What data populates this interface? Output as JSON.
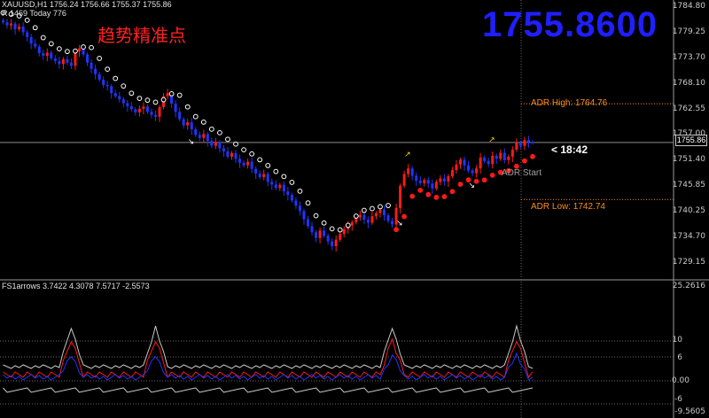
{
  "header": {
    "symbol_line": "XAUUSD,H1  1756.24 1756.66 1755.37 1755.86",
    "info_line": "R 1469  Today 776",
    "annotation_cn": "趋势精准点",
    "big_price": "1755.8600"
  },
  "labels": {
    "adr_high": "ADR High: 1764.76",
    "adr_low": "ADR Low: 1742.74",
    "adr_start": "ADR Start",
    "countdown": "< 18:42",
    "current_price": "1755.86"
  },
  "colors": {
    "bull": "#ff1a1a",
    "bear": "#1f35ff",
    "trail": "#ffffff",
    "adr": "#ff8c1a",
    "big_price": "#1f1fff",
    "arrow_up": "#ffd400"
  },
  "price_axis": {
    "ticks": [
      "1784.80",
      "1779.25",
      "1773.70",
      "1768.10",
      "1762.55",
      "1757.00",
      "1751.40",
      "1745.85",
      "1740.25",
      "1734.70",
      "1729.15"
    ]
  },
  "indicator": {
    "name_line": "FS1arrows 3.7422 4.3078 7.5717 -2.5573",
    "ticks": [
      "25.2616",
      "10",
      "6",
      "0.00",
      "-6",
      "-9.5605"
    ]
  },
  "chart_data": {
    "type": "candlestick",
    "title": "XAUUSD,H1",
    "current_price": 1755.86,
    "adr_high": 1764.76,
    "adr_low": 1742.74,
    "ylim": [
      1726.5,
      1787.0
    ],
    "close_series": [
      1783.5,
      1782.8,
      1783.2,
      1781.9,
      1782.5,
      1781.2,
      1780.1,
      1778.6,
      1777.9,
      1776.4,
      1775.8,
      1776.5,
      1775.2,
      1774.6,
      1773.9,
      1775.0,
      1774.2,
      1773.5,
      1776.8,
      1777.5,
      1776.1,
      1774.2,
      1772.8,
      1771.6,
      1770.3,
      1769.1,
      1768.8,
      1767.2,
      1766.5,
      1765.8,
      1764.9,
      1764.2,
      1763.5,
      1762.8,
      1763.6,
      1764.1,
      1762.9,
      1762.2,
      1761.8,
      1764.0,
      1766.5,
      1767.2,
      1764.8,
      1762.9,
      1761.2,
      1759.8,
      1760.5,
      1758.9,
      1757.6,
      1756.9,
      1757.8,
      1756.2,
      1755.1,
      1755.9,
      1754.5,
      1753.8,
      1752.6,
      1753.4,
      1752.1,
      1751.2,
      1750.6,
      1751.4,
      1749.8,
      1748.7,
      1747.9,
      1748.6,
      1746.8,
      1746.2,
      1745.4,
      1746.1,
      1744.6,
      1743.8,
      1742.5,
      1741.3,
      1740.1,
      1738.2,
      1736.6,
      1735.2,
      1733.9,
      1735.6,
      1734.4,
      1733.1,
      1732.0,
      1733.5,
      1734.8,
      1735.9,
      1736.8,
      1737.5,
      1738.6,
      1739.2,
      1738.1,
      1737.4,
      1738.9,
      1739.6,
      1740.4,
      1739.1,
      1737.8,
      1737.0,
      1740.8,
      1745.9,
      1748.6,
      1749.9,
      1748.2,
      1747.1,
      1746.5,
      1747.2,
      1746.4,
      1745.3,
      1746.8,
      1747.6,
      1746.9,
      1748.1,
      1749.5,
      1750.8,
      1751.9,
      1750.6,
      1749.4,
      1748.8,
      1749.9,
      1752.4,
      1751.6,
      1750.9,
      1752.8,
      1752.1,
      1753.5,
      1751.8,
      1752.6,
      1754.2,
      1755.8,
      1755.1,
      1756.4,
      1755.9,
      1755.86
    ]
  }
}
